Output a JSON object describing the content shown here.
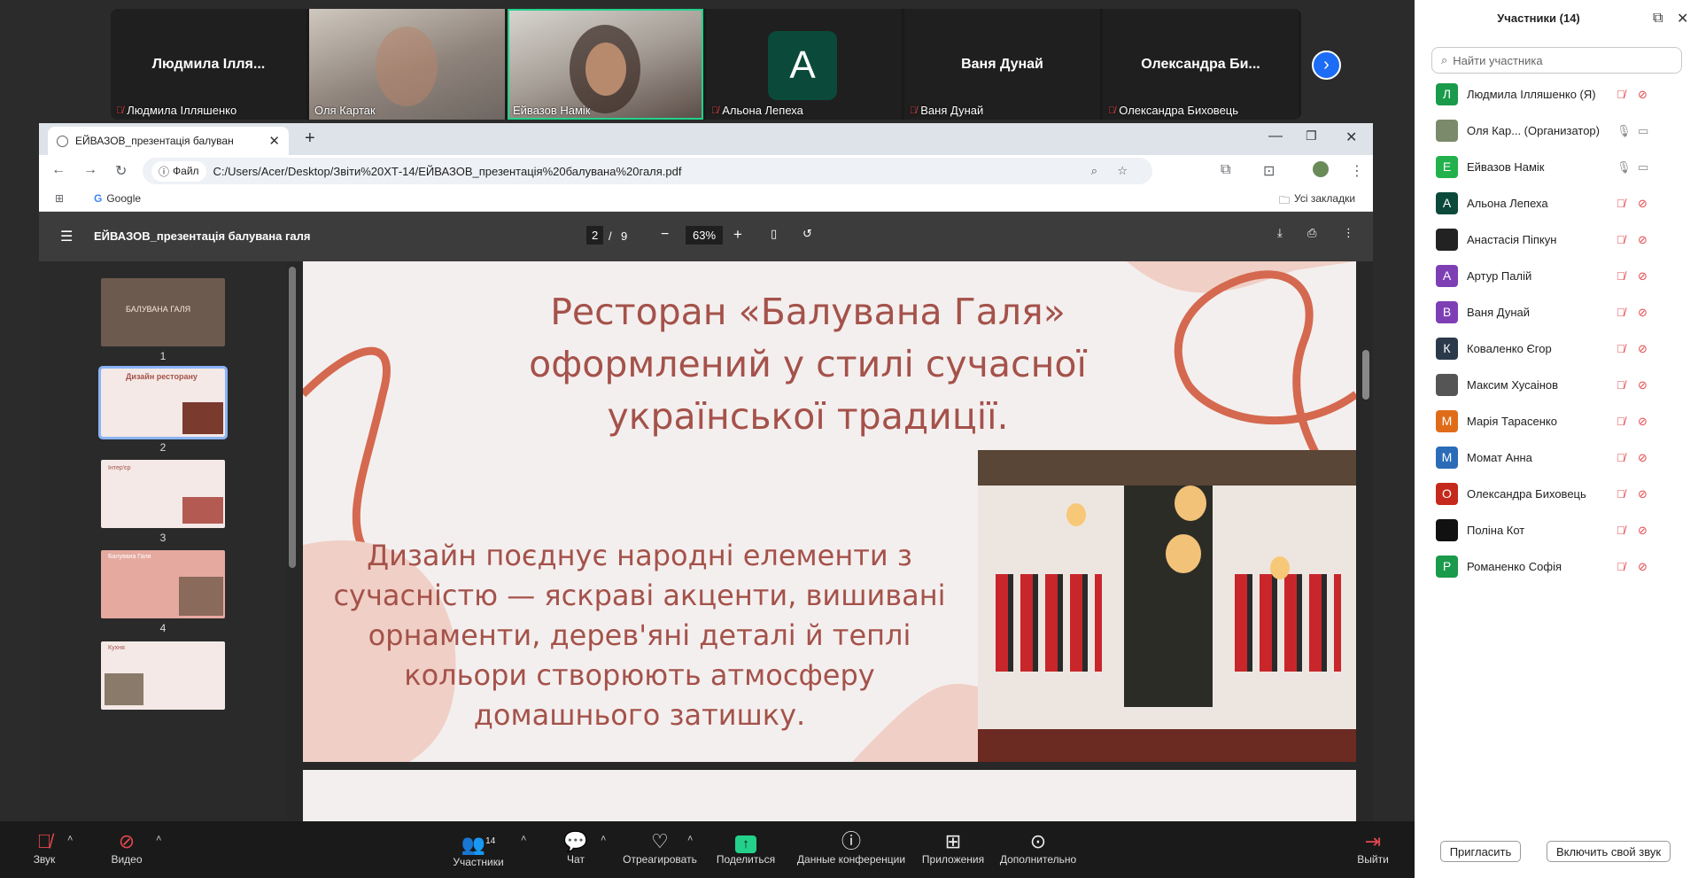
{
  "video_strip": {
    "tiles": [
      {
        "big_name": "Людмила Ілля...",
        "caption": "Людмила Ілляшенко",
        "muted": true
      },
      {
        "big_name": "",
        "caption": "Оля Картак",
        "muted": false
      },
      {
        "big_name": "",
        "caption": "Ейвазов Намік",
        "muted": false
      },
      {
        "big_name": "",
        "avatar_letter": "A",
        "caption": "Альона Лепеха",
        "muted": true
      },
      {
        "big_name": "Ваня Дунай",
        "caption": "Ваня Дунай",
        "muted": true
      },
      {
        "big_name": "Олександра Би...",
        "caption": "Олександра Биховець",
        "muted": true
      }
    ]
  },
  "browser": {
    "tab_title": "ЕЙВАЗОВ_презентація балуван",
    "address_chip": "Файл",
    "address": "C:/Users/Acer/Desktop/Звіти%20ХТ-14/ЕЙВАЗОВ_презентація%20балувана%20галя.pdf",
    "bookmark_google": "Google",
    "bookmark_all": "Усі закладки"
  },
  "pdf": {
    "title": "ЕЙВАЗОВ_презентація балувана галя",
    "current_page": "2",
    "page_sep": "/",
    "total_pages": "9",
    "zoom": "63%",
    "thumbs": [
      {
        "num": "1",
        "label": "БАЛУВАНА ГАЛЯ"
      },
      {
        "num": "2",
        "label": "Дизайн ресторану"
      },
      {
        "num": "3",
        "label": "Інтер'єр"
      },
      {
        "num": "4",
        "label": "Балувана Галя"
      },
      {
        "num": "5",
        "label": "Кухня"
      }
    ],
    "slide_title": "Ресторан «Балувана Галя» оформлений у стилі сучасної української традиції.",
    "slide_body": "Дизайн поєднує народні елементи з сучасністю — яскраві акценти, вишивані орнаменти, дерев'яні деталі й теплі кольори створюють атмосферу домашнього затишку."
  },
  "sidebar": {
    "title": "Участники (14)",
    "search_placeholder": "Найти участника",
    "participants": [
      {
        "letter": "Л",
        "color": "#1a9a4b",
        "name": "Людмила Ілляшенко (Я)",
        "mic": "off",
        "cam": "off"
      },
      {
        "letter": "",
        "color": "#7a8a6a",
        "name": "Оля Кар...  (Организатор)",
        "mic": "on",
        "cam": "on"
      },
      {
        "letter": "Е",
        "color": "#22b14c",
        "name": "Ейвазов Намік",
        "mic": "on",
        "cam": "on"
      },
      {
        "letter": "А",
        "color": "#0b4a3a",
        "name": "Альона Лепеха",
        "mic": "off",
        "cam": "off"
      },
      {
        "letter": "",
        "color": "#222",
        "name": "Анастасія Піпкун",
        "mic": "off",
        "cam": "off"
      },
      {
        "letter": "А",
        "color": "#7e3fb5",
        "name": "Артур Палій",
        "mic": "off",
        "cam": "off"
      },
      {
        "letter": "В",
        "color": "#7e3fb5",
        "name": "Ваня Дунай",
        "mic": "off",
        "cam": "off"
      },
      {
        "letter": "К",
        "color": "#2b3a4a",
        "name": "Коваленко Єгор",
        "mic": "off",
        "cam": "off"
      },
      {
        "letter": "",
        "color": "#555",
        "name": "Максим Хусаінов",
        "mic": "off",
        "cam": "off"
      },
      {
        "letter": "М",
        "color": "#e06c1a",
        "name": "Марія Тарасенко",
        "mic": "off",
        "cam": "off"
      },
      {
        "letter": "М",
        "color": "#2a6cb8",
        "name": "Момат Анна",
        "mic": "off",
        "cam": "off"
      },
      {
        "letter": "О",
        "color": "#c5281c",
        "name": "Олександра Биховець",
        "mic": "off",
        "cam": "off"
      },
      {
        "letter": "",
        "color": "#111",
        "name": "Поліна Кот",
        "mic": "off",
        "cam": "off"
      },
      {
        "letter": "Р",
        "color": "#1a9a4b",
        "name": "Романенко Софія",
        "mic": "off",
        "cam": "off"
      }
    ],
    "invite_label": "Пригласить",
    "unmute_label": "Включить свой звук"
  },
  "bottombar": {
    "sound": "Звук",
    "video": "Видео",
    "participants": "Участники",
    "participants_count": "14",
    "chat": "Чат",
    "react": "Отреагировать",
    "share": "Поделиться",
    "info": "Данные конференции",
    "apps": "Приложения",
    "more": "Дополнительно",
    "leave": "Выйти"
  }
}
